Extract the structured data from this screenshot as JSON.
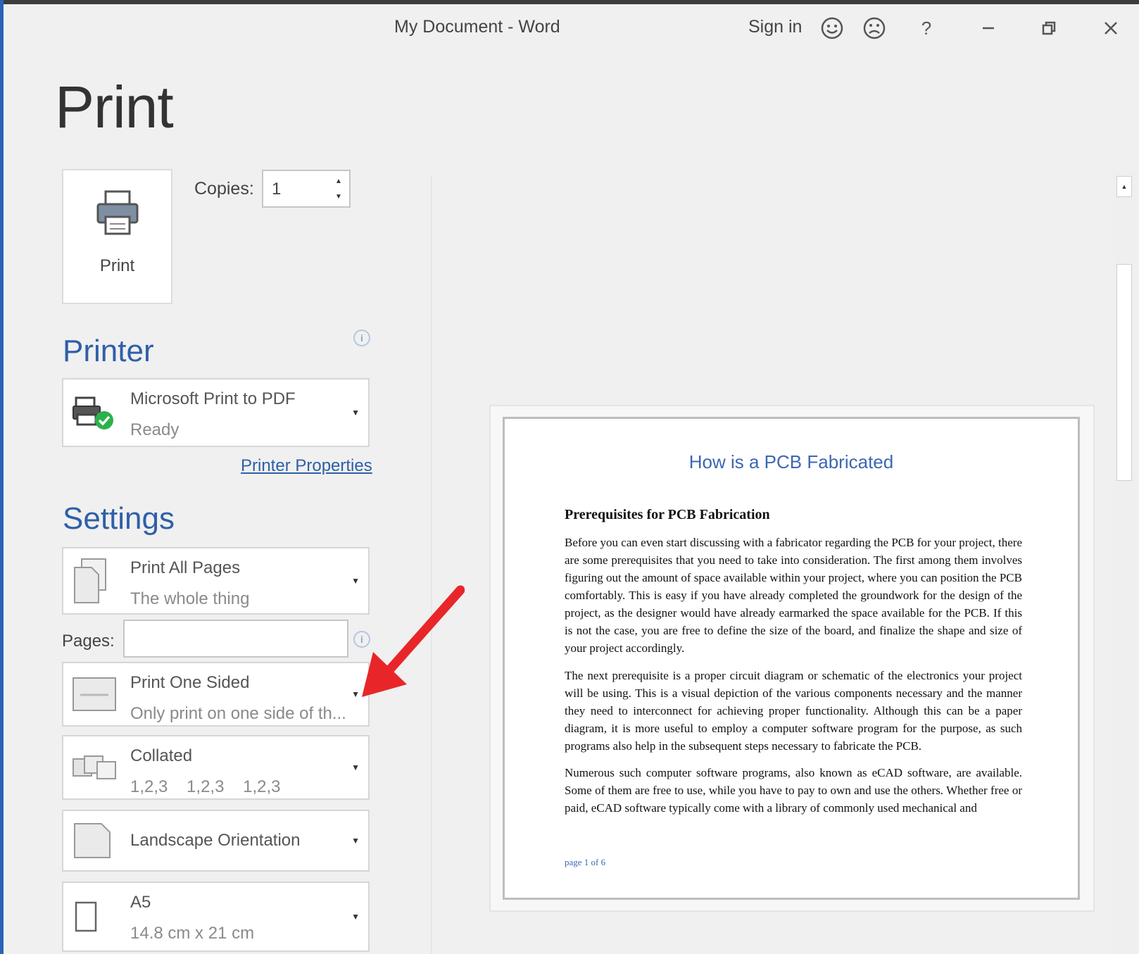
{
  "window": {
    "title": "My Document  -  Word",
    "sign_in": "Sign in",
    "help": "?"
  },
  "heading": "Print",
  "print_button": {
    "label": "Print"
  },
  "copies": {
    "label": "Copies:",
    "value": "1"
  },
  "printer": {
    "section_title": "Printer",
    "name": "Microsoft Print to PDF",
    "status": "Ready",
    "properties_link": "Printer Properties"
  },
  "settings": {
    "section_title": "Settings",
    "print_range": {
      "title": "Print All Pages",
      "subtitle": "The whole thing"
    },
    "pages": {
      "label": "Pages:",
      "value": ""
    },
    "sides": {
      "title": "Print One Sided",
      "subtitle": "Only print on one side of th..."
    },
    "collation": {
      "title": "Collated",
      "subtitle": "1,2,3    1,2,3    1,2,3"
    },
    "orientation": {
      "title": "Landscape Orientation"
    },
    "paper": {
      "title": "A5",
      "subtitle": "14.8 cm x 21 cm"
    }
  },
  "preview": {
    "title": "How is a PCB Fabricated",
    "subheading": "Prerequisites for PCB Fabrication",
    "paragraphs": [
      "Before you can even start discussing with a fabricator regarding the PCB for your project, there are some prerequisites that you need to take into consideration. The first among them involves figuring out the amount of space available within your project, where you can position the PCB comfortably. This is easy if you have already completed the groundwork for the design of the project, as the designer would have already earmarked the space available for the PCB. If this is not the case, you are free to define the size of the board, and finalize the shape and size of your project accordingly.",
      "The next prerequisite is a proper circuit diagram or schematic of the electronics your project will be using. This is a visual depiction of the various components necessary and the manner they need to interconnect for achieving proper functionality. Although this can be a paper diagram, it is more useful to employ a computer software program for the purpose, as such programs also help in the subsequent steps necessary to fabricate the PCB.",
      "Numerous such computer software programs, also known as eCAD software, are available. Some of them are free to use, while you have to pay to own and use the others. Whether free or paid, eCAD software typically come with a library of commonly used mechanical and"
    ],
    "footer": "page 1 of 6"
  },
  "colors": {
    "accent": "#2f5fa8",
    "annotation_arrow": "#e8262a",
    "status_ok": "#2bb24c"
  }
}
